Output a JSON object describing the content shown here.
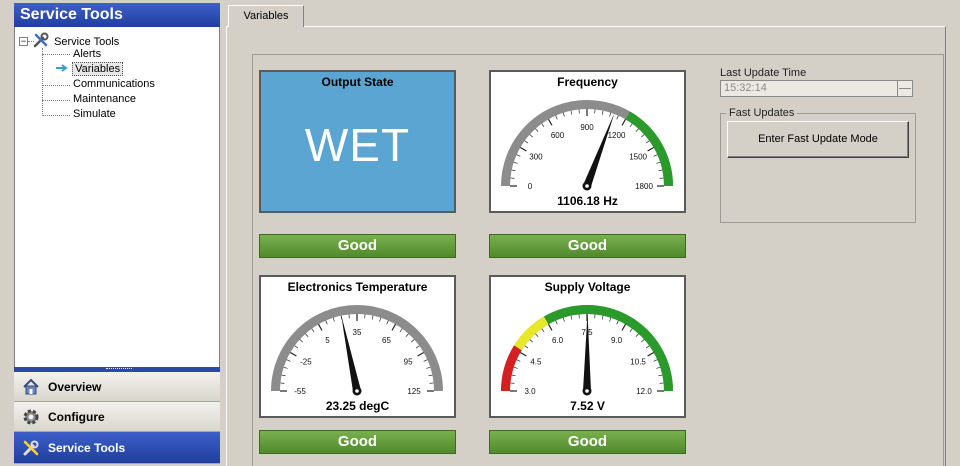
{
  "sidebar": {
    "title": "Service Tools",
    "tree": {
      "root": "Service Tools",
      "children": [
        "Alerts",
        "Variables",
        "Communications",
        "Maintenance",
        "Simulate"
      ],
      "selected": "Variables"
    },
    "nav": [
      {
        "label": "Overview",
        "icon": "home-icon"
      },
      {
        "label": "Configure",
        "icon": "gear-icon"
      },
      {
        "label": "Service Tools",
        "icon": "tools-icon",
        "active": true
      }
    ]
  },
  "tabs": [
    {
      "label": "Variables",
      "active": true
    }
  ],
  "output_state": {
    "title": "Output State",
    "value": "WET",
    "status": "Good",
    "color": "#5aa5d2"
  },
  "frequency": {
    "title": "Frequency",
    "readout": "1106.18 Hz",
    "value": 1106.18,
    "min": 0,
    "max": 1800,
    "ticks": [
      "0",
      "300",
      "600",
      "900",
      "1200",
      "1500",
      "1800"
    ],
    "status": "Good"
  },
  "temperature": {
    "title": "Electronics Temperature",
    "readout": "23.25 degC",
    "value": 23.25,
    "min": -55,
    "max": 125,
    "ticks": [
      "-55",
      "-25",
      "5",
      "35",
      "65",
      "95",
      "125"
    ],
    "status": "Good"
  },
  "voltage": {
    "title": "Supply Voltage",
    "readout": "7.52 V",
    "value": 7.52,
    "min": 3.0,
    "max": 12.0,
    "ticks": [
      "3.0",
      "4.5",
      "6.0",
      "7.5",
      "9.0",
      "10.5",
      "12.0"
    ],
    "status": "Good"
  },
  "last_update": {
    "label": "Last Update Time",
    "value": "15:32:14"
  },
  "fast_updates": {
    "legend": "Fast Updates",
    "button": "Enter Fast Update Mode"
  },
  "colors": {
    "good": "#5e9a38",
    "gauge_green": "#2a9a2a",
    "gauge_yellow": "#e8e82a",
    "gauge_red": "#d42020",
    "selection": "#1f3f9f"
  }
}
